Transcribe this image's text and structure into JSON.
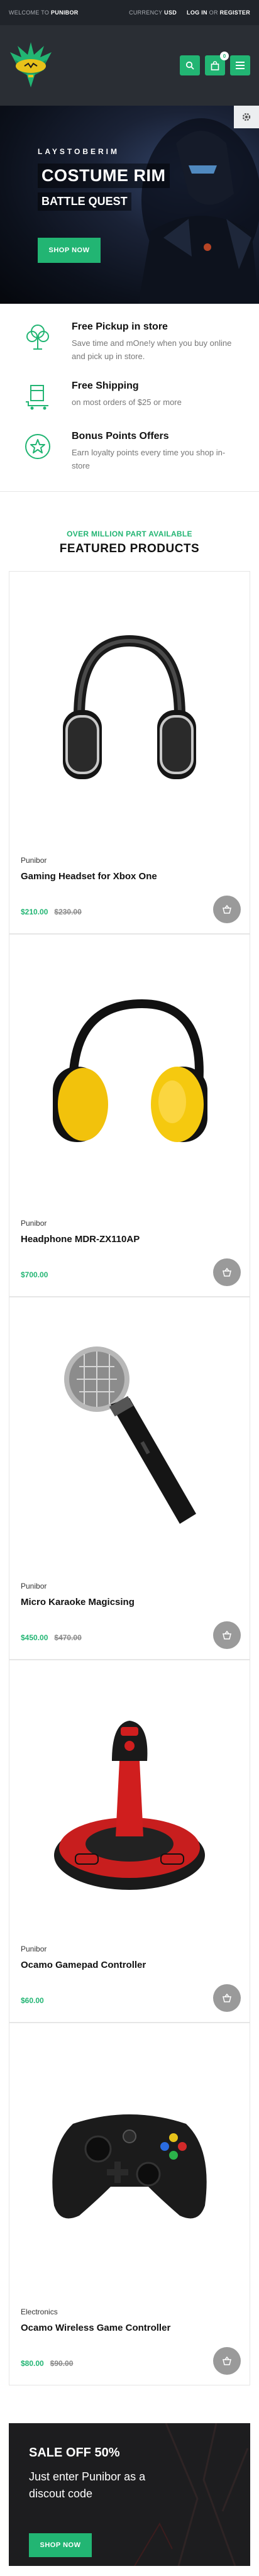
{
  "topbar": {
    "welcome_prefix": "WELCOME TO ",
    "welcome_brand": "PUNIBOR",
    "currency_label": "CURRENCY",
    "currency_value": "USD",
    "login": "LOG IN",
    "or": "OR",
    "register": "REGISTER"
  },
  "header": {
    "cart_count": "0"
  },
  "hero": {
    "subtitle": "LAYSTOBERIM",
    "title": "COSTUME RIM",
    "title2": "BATTLE QUEST",
    "cta": "SHOP NOW"
  },
  "features": [
    {
      "title": "Free Pickup in store",
      "text": "Save time and mOne!y when you buy online and pick up in store."
    },
    {
      "title": "Free Shipping",
      "text": "on most orders of $25 or more"
    },
    {
      "title": "Bonus Points Offers",
      "text": "Earn loyalty points every time you shop in-store"
    }
  ],
  "featured": {
    "tag": "OVER MILLION PART AVAILABLE",
    "title": "FEATURED PRODUCTS"
  },
  "products": [
    {
      "vendor": "Punibor",
      "name": "Gaming Headset for Xbox One",
      "price": "$210.00",
      "old_price": "$230.00"
    },
    {
      "vendor": "Punibor",
      "name": "Headphone MDR-ZX110AP",
      "price": "$700.00",
      "old_price": ""
    },
    {
      "vendor": "Punibor",
      "name": "Micro Karaoke Magicsing",
      "price": "$450.00",
      "old_price": "$470.00"
    },
    {
      "vendor": "Punibor",
      "name": "Ocamo Gamepad Controller",
      "price": "$60.00",
      "old_price": ""
    },
    {
      "vendor": "Electronics",
      "name": "Ocamo Wireless Game Controller",
      "price": "$80.00",
      "old_price": "$90.00"
    }
  ],
  "promo": {
    "title": "SALE OFF 50%",
    "text": "Just enter Punibor as a discout code",
    "cta": "SHOP NOW"
  },
  "colors": {
    "accent": "#22b573",
    "topbar_bg": "#20242a",
    "header_bg": "#2a2e34"
  }
}
